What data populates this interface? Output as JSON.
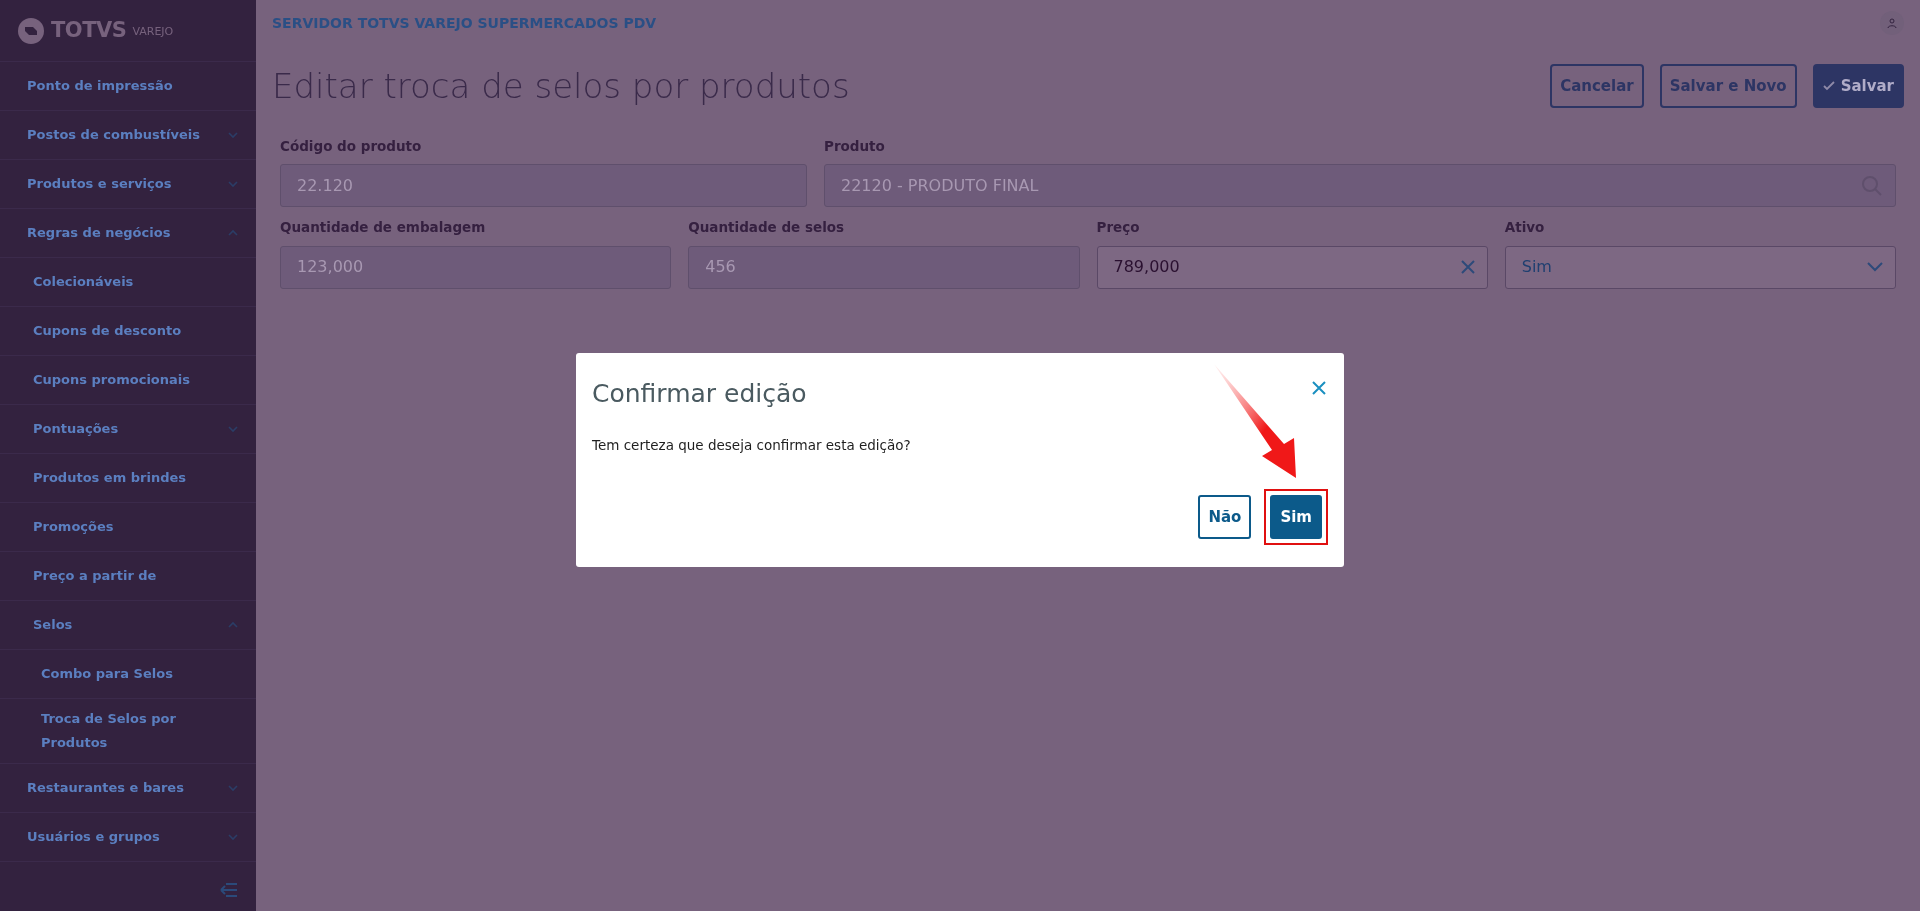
{
  "sidebar": {
    "logo": {
      "brand": "TOTVS",
      "product": "VAREJO"
    },
    "items": [
      {
        "label": "Ponto de impressão"
      },
      {
        "label": "Postos de combustíveis",
        "expanded": false
      },
      {
        "label": "Produtos e serviços",
        "expanded": false
      },
      {
        "label": "Regras de negócios",
        "expanded": true,
        "children": [
          {
            "label": "Colecionáveis"
          },
          {
            "label": "Cupons de desconto"
          },
          {
            "label": "Cupons promocionais"
          },
          {
            "label": "Pontuações",
            "expanded": false
          },
          {
            "label": "Produtos em brindes"
          },
          {
            "label": "Promoções"
          },
          {
            "label": "Preço a partir de"
          },
          {
            "label": "Selos",
            "expanded": true,
            "children": [
              {
                "label": "Combo para Selos"
              },
              {
                "label": "Troca de Selos por Produtos"
              }
            ]
          }
        ]
      },
      {
        "label": "Restaurantes e bares",
        "expanded": false
      },
      {
        "label": "Usuários e grupos",
        "expanded": false
      }
    ]
  },
  "header": {
    "server": "SERVIDOR TOTVS VAREJO SUPERMERCADOS PDV"
  },
  "page": {
    "title": "Editar troca de selos por produtos",
    "buttons": [
      {
        "label": "Cancelar",
        "kind": "outline"
      },
      {
        "label": "Salvar e Novo",
        "kind": "outline"
      },
      {
        "label": "Salvar",
        "kind": "primary"
      }
    ]
  },
  "form": {
    "product_fields": [
      {
        "label": "Código do produto",
        "value": "22.120",
        "kind": "text",
        "disabled": true
      },
      {
        "label": "Produto",
        "value": "22120 - PRODUTO FINAL",
        "kind": "lookup",
        "disabled": true
      }
    ],
    "value_fields": [
      {
        "label": "Quantidade de embalagem",
        "value": "123,000",
        "kind": "text",
        "disabled": true
      },
      {
        "label": "Quantidade de selos",
        "value": "456",
        "kind": "text",
        "disabled": true
      },
      {
        "label": "Preço",
        "value": "789,000",
        "kind": "clearable",
        "disabled": false
      },
      {
        "label": "Ativo",
        "value": "Sim",
        "kind": "select",
        "disabled": false
      }
    ]
  },
  "dialog": {
    "title": "Confirmar edição",
    "message": "Tem certeza que deseja confirmar esta edição?",
    "buttons": [
      {
        "label": "Não",
        "kind": "outline",
        "highlighted": false
      },
      {
        "label": "Sim",
        "kind": "primary",
        "highlighted": true
      }
    ]
  }
}
